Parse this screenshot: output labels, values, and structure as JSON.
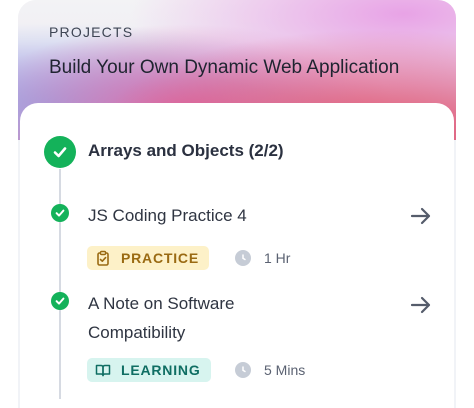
{
  "header": {
    "kicker": "PROJECTS",
    "course_title": "Build Your Own Dynamic Web Application"
  },
  "module": {
    "title": "Arrays and Objects (2/2)",
    "status_icon": "check-circle-icon",
    "status_color": "#14b25a"
  },
  "items": [
    {
      "title_lines": [
        "JS Coding Practice 4"
      ],
      "badge": {
        "label": "PRACTICE",
        "icon": "clipboard-check-icon",
        "bg": "#fdf1c8",
        "fg": "#9a6a12"
      },
      "duration": "1 Hr",
      "status_icon": "check-circle-icon",
      "action_icon": "arrow-right-icon"
    },
    {
      "title_lines": [
        "A Note on Software",
        "Compatibility"
      ],
      "badge": {
        "label": "LEARNING",
        "icon": "book-open-icon",
        "bg": "#d7f4ef",
        "fg": "#0f6e63"
      },
      "duration": "5 Mins",
      "status_icon": "check-circle-icon",
      "action_icon": "arrow-right-icon"
    }
  ]
}
